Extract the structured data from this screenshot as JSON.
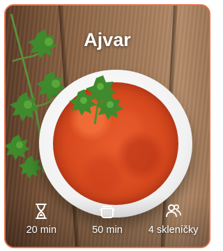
{
  "recipe": {
    "title": "Ajvar",
    "stats": [
      {
        "icon": "hourglass-icon",
        "label": "20 min"
      },
      {
        "icon": "cooking-pot-icon",
        "label": "50 min"
      },
      {
        "icon": "people-icon",
        "label": "4 skleníčky"
      }
    ]
  },
  "colors": {
    "card_border": "#e8734a",
    "sauce": "#d84a1e",
    "text": "#ffffff"
  }
}
